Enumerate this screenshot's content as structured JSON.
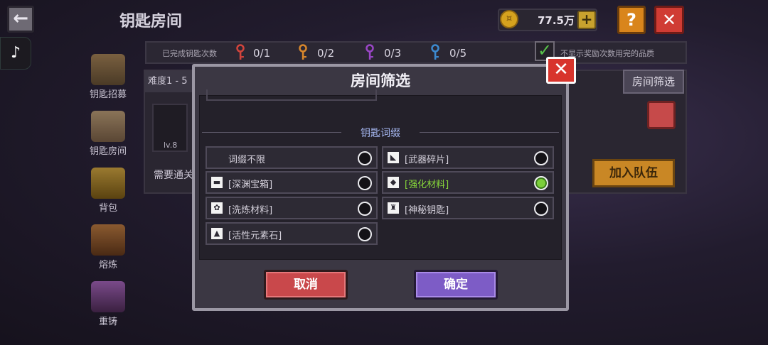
{
  "header": {
    "title": "钥匙房间",
    "coins": "77.5万",
    "back_icon": "←",
    "plus_icon": "+",
    "help_icon": "?",
    "close_icon": "✕",
    "tiktok_icon": "♪"
  },
  "stats": {
    "label": "已完成钥匙次数",
    "keys": [
      {
        "color": "#d2443c",
        "value": "0/1"
      },
      {
        "color": "#d8872c",
        "value": "0/2"
      },
      {
        "color": "#9a46c6",
        "value": "0/3"
      },
      {
        "color": "#3c8ad0",
        "value": "0/5"
      }
    ],
    "hide_label": "不显示奖励次数用完的品质",
    "hide_checked": true
  },
  "nav": [
    {
      "label": "钥匙招募",
      "color": "#6b5538"
    },
    {
      "label": "钥匙房间",
      "color": "#7a6550"
    },
    {
      "label": "背包",
      "color": "#8a6a2a"
    },
    {
      "label": "熔炼",
      "color": "#7a4a2a"
    },
    {
      "label": "重铸",
      "color": "#6a3a7a"
    }
  ],
  "background": {
    "difficulty": "难度1 - 5",
    "filter_button": "房间筛选",
    "item_level": "lv.8",
    "need_text": "需要通关",
    "join_button": "加入队伍"
  },
  "modal": {
    "title": "房间筛选",
    "section_title": "钥匙词缀",
    "close_icon": "✕",
    "options": [
      {
        "label": "词缀不限",
        "icon": "",
        "selected": false
      },
      {
        "label": "[武器碎片]",
        "icon": "◣",
        "selected": false
      },
      {
        "label": "[深渊宝箱]",
        "icon": "▬",
        "selected": false
      },
      {
        "label": "[强化材料]",
        "icon": "◆",
        "selected": true
      },
      {
        "label": "[洗炼材料]",
        "icon": "✿",
        "selected": false
      },
      {
        "label": "[神秘钥匙]",
        "icon": "♜",
        "selected": false
      },
      {
        "label": "[活性元素石]",
        "icon": "▲",
        "selected": false
      }
    ],
    "cancel": "取消",
    "confirm": "确定"
  }
}
